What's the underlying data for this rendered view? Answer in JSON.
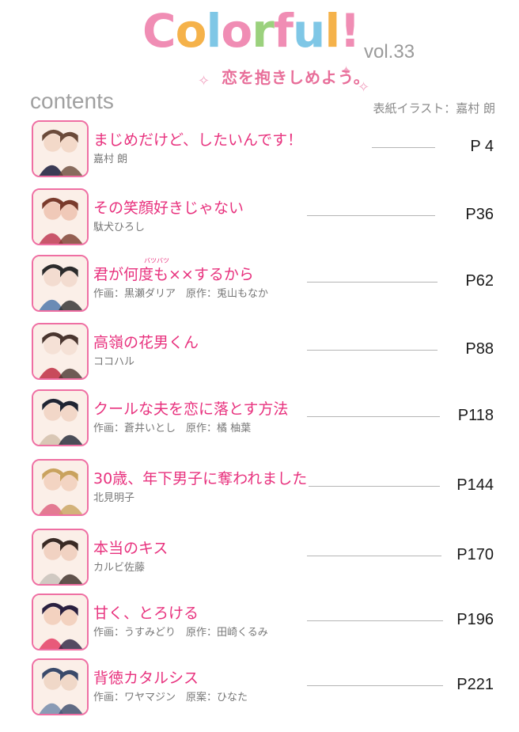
{
  "header": {
    "logo_letters": [
      "C",
      "o",
      "l",
      "o",
      "r",
      "f",
      "u",
      "l",
      "!"
    ],
    "logo_colors": [
      "#f08db4",
      "#f5b24a",
      "#7fc7e6",
      "#f08db4",
      "#9bd17d",
      "#f08db4",
      "#7fc7e6",
      "#f5b24a",
      "#f08db4"
    ],
    "volume": "vol.33",
    "subtitle": "恋を抱きしめよう。",
    "contents_label": "contents",
    "cover_credit": "表紙イラスト：嘉村 朗"
  },
  "entries": [
    {
      "title": "まじめだけど、したいんです！",
      "author": "嘉村 朗",
      "page": "P 4"
    },
    {
      "title": "その笑顔好きじゃない",
      "author": "駄犬ひろし",
      "page": "P36"
    },
    {
      "title": "君が何度も××するから",
      "author": "作画：黒瀬ダリア　原作：兎山もなか",
      "page": "P62",
      "ruby": "バツバツ"
    },
    {
      "title": "高嶺の花男くん",
      "author": "ココハル",
      "page": "P88"
    },
    {
      "title": "クールな夫を恋に落とす方法",
      "author": "作画：蒼井いとし　原作：橘 柚葉",
      "page": "P118"
    },
    {
      "title": "30歳、年下男子に奪われました",
      "author": "北見明子",
      "page": "P144"
    },
    {
      "title": "本当のキス",
      "author": "カルビ佐藤",
      "page": "P170"
    },
    {
      "title": "甘く、とろける",
      "author": "作画：うすみどり　原作：田崎くるみ",
      "page": "P196"
    },
    {
      "title": "背徳カタルシス",
      "author": "作画：ワヤマジン　原案：ひなた",
      "page": "P221"
    }
  ],
  "colors": {
    "accent_pink": "#e8327e",
    "thumb_border": "#ef6fa3",
    "rule_gray": "#b5b5b5"
  }
}
